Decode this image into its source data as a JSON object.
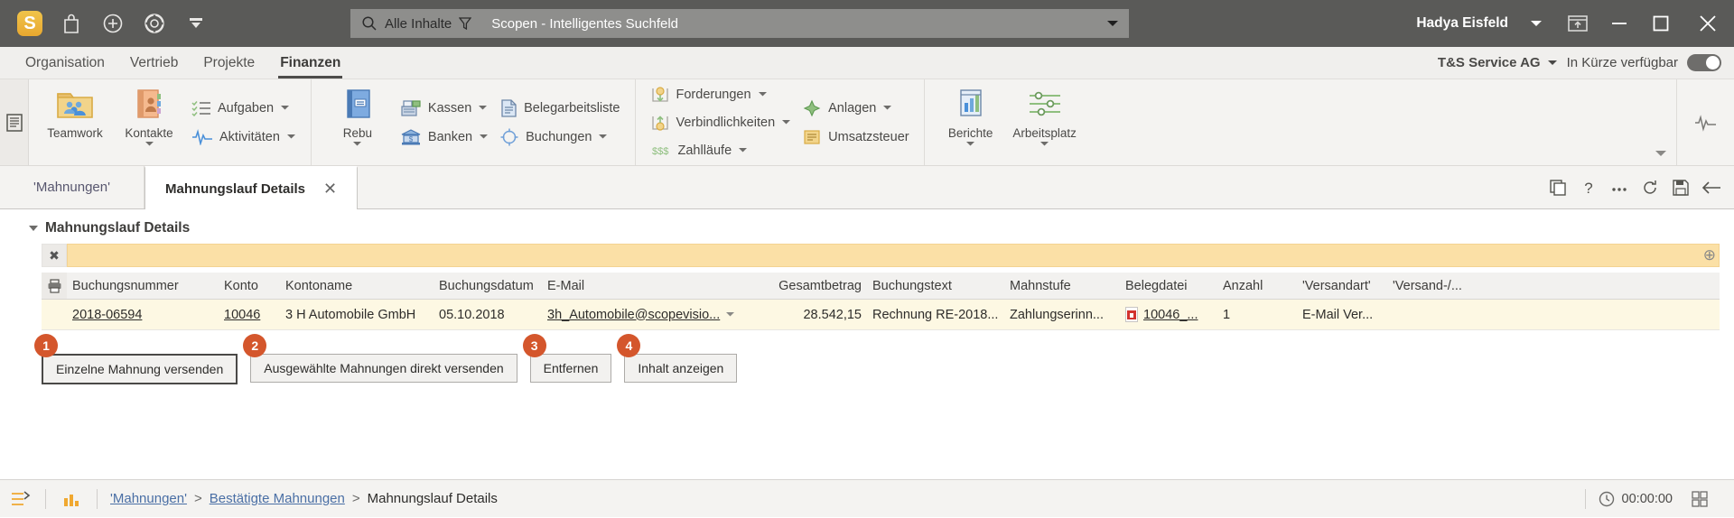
{
  "titlebar": {
    "icons": [
      "app-logo",
      "shop-bag",
      "plus-circle",
      "lifebuoy",
      "chevron-stack"
    ],
    "logo_letter": "S",
    "search": {
      "filter_label": "Alle Inhalte",
      "placeholder": "Scopen - Intelligentes Suchfeld"
    },
    "user_name": "Hadya Eisfeld",
    "window_buttons": [
      "restore-panel",
      "minimize",
      "maximize",
      "close"
    ]
  },
  "menubar": {
    "items": [
      {
        "label": "Organisation",
        "active": false
      },
      {
        "label": "Vertrieb",
        "active": false
      },
      {
        "label": "Projekte",
        "active": false
      },
      {
        "label": "Finanzen",
        "active": true
      }
    ],
    "company": "T&S Service AG",
    "availability": "In Kürze verfügbar"
  },
  "ribbon": {
    "group1": {
      "big": [
        {
          "label": "Teamwork",
          "icon": "teamwork-folder-icon",
          "caret": false
        },
        {
          "label": "Kontakte",
          "icon": "contacts-book-icon",
          "caret": true
        }
      ],
      "small": [
        {
          "label": "Aufgaben",
          "icon": "tasks-icon",
          "caret": true
        },
        {
          "label": "Aktivitäten",
          "icon": "activities-icon",
          "caret": true
        }
      ]
    },
    "group2": {
      "big": [
        {
          "label": "Rebu",
          "icon": "rebu-book-icon",
          "caret": true
        }
      ],
      "small": [
        {
          "label": "Kassen",
          "icon": "cash-register-icon",
          "caret": true
        },
        {
          "label": "Banken",
          "icon": "bank-icon",
          "caret": true
        }
      ],
      "small2": [
        {
          "label": "Belegarbeitsliste",
          "icon": "document-list-icon",
          "caret": false
        },
        {
          "label": "Buchungen",
          "icon": "bookings-icon",
          "caret": true
        }
      ]
    },
    "group3": {
      "small": [
        {
          "label": "Forderungen",
          "icon": "receivables-coin-down-icon",
          "caret": true
        },
        {
          "label": "Verbindlichkeiten",
          "icon": "payables-coin-up-icon",
          "caret": true
        },
        {
          "label": "Zahlläufe",
          "icon": "payment-runs-icon",
          "caret": true
        }
      ],
      "small2": [
        {
          "label": "Anlagen",
          "icon": "assets-icon",
          "caret": true
        },
        {
          "label": "Umsatzsteuer",
          "icon": "vat-icon",
          "caret": false
        }
      ]
    },
    "group4": {
      "big": [
        {
          "label": "Berichte",
          "icon": "reports-chart-icon",
          "caret": true
        },
        {
          "label": "Arbeitsplatz",
          "icon": "workspace-icon",
          "caret": true
        }
      ]
    }
  },
  "tabs": [
    {
      "label": "'Mahnungen'",
      "active": false,
      "closable": false
    },
    {
      "label": "Mahnungslauf Details",
      "active": true,
      "closable": true
    }
  ],
  "tabstrip_icons": [
    "duplicate-icon",
    "help-icon",
    "more-options-icon",
    "refresh-icon",
    "save-icon",
    "back-arrow-icon"
  ],
  "panel": {
    "title": "Mahnungslauf Details",
    "filter_close_label": "✖"
  },
  "grid": {
    "columns": [
      "Buchungsnummer",
      "Konto",
      "Kontoname",
      "Buchungsdatum",
      "E-Mail",
      "Gesamtbetrag",
      "Buchungstext",
      "Mahnstufe",
      "Belegdatei",
      "Anzahl",
      "'Versandart'",
      "'Versand-/..."
    ],
    "rows": [
      {
        "buchungsnummer": "2018-06594",
        "konto": "10046",
        "kontoname": "3 H Automobile GmbH",
        "buchungsdatum": "05.10.2018",
        "email": "3h_Automobile@scopevisio...",
        "gesamtbetrag": "28.542,15",
        "buchungstext": "Rechnung RE-2018...",
        "mahnstufe": "Zahlungserinn...",
        "belegdatei": "10046_...",
        "anzahl": "1",
        "versandart": "E-Mail Ver...",
        "versand": ""
      }
    ]
  },
  "action_buttons": [
    {
      "number": "1",
      "label": "Einzelne Mahnung versenden"
    },
    {
      "number": "2",
      "label": "Ausgewählte Mahnungen direkt versenden"
    },
    {
      "number": "3",
      "label": "Entfernen"
    },
    {
      "number": "4",
      "label": "Inhalt anzeigen"
    }
  ],
  "footer": {
    "icons": [
      "workflow-icon",
      "chart-bars-icon"
    ],
    "breadcrumbs": [
      {
        "label": "'Mahnungen'",
        "link": true
      },
      {
        "label": ">",
        "link": false
      },
      {
        "label": "Bestätigte Mahnungen",
        "link": true
      },
      {
        "label": ">",
        "link": false
      },
      {
        "label": "Mahnungslauf Details",
        "link": false
      }
    ],
    "clock": "00:00:00",
    "clock_icon": "clock-icon",
    "trailing_icons": [
      "grid-icon"
    ]
  },
  "colors": {
    "titlebar_bg": "#5a5a58",
    "accent_yellow": "#fbe0a6",
    "row_bg": "#fdf8e3",
    "badge": "#d4562c",
    "logo": "#e8a830",
    "link": "#4a6fa5"
  }
}
